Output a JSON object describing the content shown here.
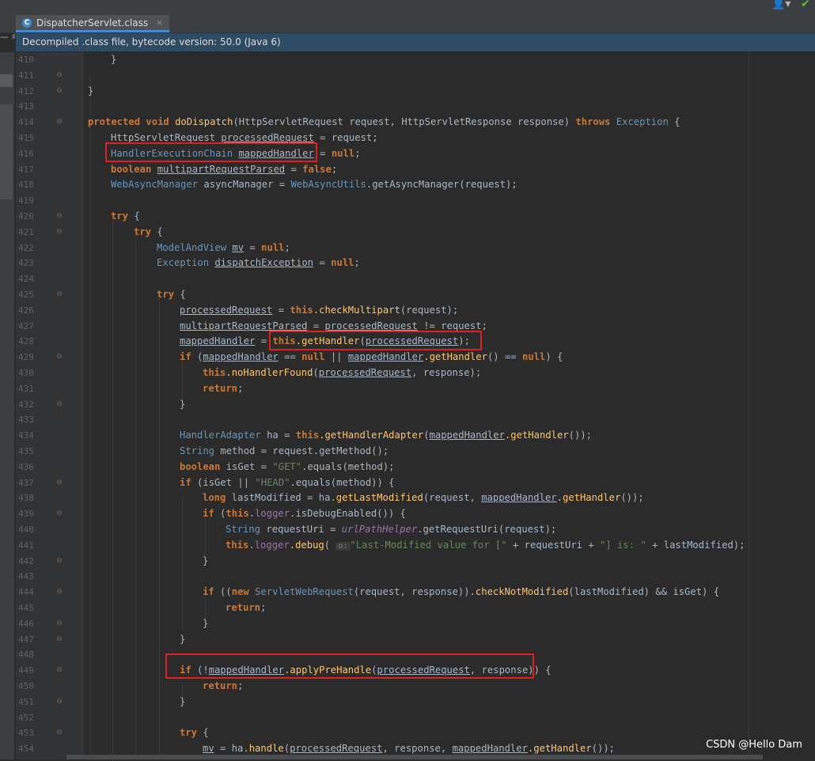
{
  "tab": {
    "icon": "C",
    "label": "DispatcherServlet.class",
    "close": "×"
  },
  "left_marks": "— ♯\\",
  "banner": "Decompiled .class file, bytecode version: 50.0 (Java 6)",
  "toolbar": {
    "user_glyph": "👤▾",
    "check_glyph": "✔"
  },
  "watermark": "CSDN @Hello Dam",
  "lines": [
    {
      "n": "410",
      "indent": 4
    },
    {
      "n": "411",
      "indent": 0
    },
    {
      "n": "412",
      "indent": 0
    },
    {
      "n": "413",
      "indent": 0
    },
    {
      "n": "414",
      "indent": 0
    },
    {
      "n": "415",
      "indent": 0
    },
    {
      "n": "416",
      "indent": 0
    },
    {
      "n": "417",
      "indent": 0
    },
    {
      "n": "418",
      "indent": 0
    },
    {
      "n": "419",
      "indent": 0
    },
    {
      "n": "420",
      "indent": 0
    },
    {
      "n": "421",
      "indent": 0
    },
    {
      "n": "422",
      "indent": 0
    },
    {
      "n": "423",
      "indent": 0
    },
    {
      "n": "424",
      "indent": 0
    },
    {
      "n": "425",
      "indent": 0
    },
    {
      "n": "426",
      "indent": 0
    },
    {
      "n": "427",
      "indent": 0
    },
    {
      "n": "428",
      "indent": 0
    },
    {
      "n": "429",
      "indent": 0
    },
    {
      "n": "430",
      "indent": 0
    },
    {
      "n": "431",
      "indent": 0
    },
    {
      "n": "432",
      "indent": 0
    },
    {
      "n": "433",
      "indent": 0
    },
    {
      "n": "434",
      "indent": 0
    },
    {
      "n": "435",
      "indent": 0
    },
    {
      "n": "436",
      "indent": 0
    },
    {
      "n": "437",
      "indent": 0
    },
    {
      "n": "438",
      "indent": 0
    },
    {
      "n": "439",
      "indent": 0
    },
    {
      "n": "440",
      "indent": 0
    },
    {
      "n": "441",
      "indent": 0
    },
    {
      "n": "442",
      "indent": 0
    },
    {
      "n": "443",
      "indent": 0
    },
    {
      "n": "444",
      "indent": 0
    },
    {
      "n": "445",
      "indent": 0
    },
    {
      "n": "446",
      "indent": 0
    },
    {
      "n": "447",
      "indent": 0
    },
    {
      "n": "448",
      "indent": 0
    },
    {
      "n": "449",
      "indent": 0
    },
    {
      "n": "450",
      "indent": 0
    },
    {
      "n": "451",
      "indent": 0
    },
    {
      "n": "452",
      "indent": 0
    },
    {
      "n": "453",
      "indent": 0
    },
    {
      "n": "454",
      "indent": 0
    }
  ],
  "code": {
    "l410": "}",
    "l412": "}",
    "l414_kw1": "protected",
    "l414_kw2": "void",
    "l414_fn": "doDispatch",
    "l414_rest": "(HttpServletRequest request, HttpServletResponse response) ",
    "l414_kw3": "throws",
    "l414_exc": "Exception",
    "l414_end": " {",
    "l415_type": "HttpServletRequest ",
    "l415_var": "processedRequest",
    "l415_rest": " = request;",
    "l416_type": "HandlerExecutionChain",
    "l416_var": "mappedHandler",
    "l416_eq": " = ",
    "l416_null": "null",
    "l416_end": ";",
    "l417_kw": "boolean",
    "l417_var": "multipartRequestParsed",
    "l417_eq": " = ",
    "l417_false": "false",
    "l417_end": ";",
    "l418_type": "WebAsyncManager",
    "l418_mid": " asyncManager = ",
    "l418_cls": "WebAsyncUtils",
    "l418_rest": ".getAsyncManager(request);",
    "l420_kw": "try",
    "l420_end": " {",
    "l421_kw": "try",
    "l421_end": " {",
    "l422_type": "ModelAndView",
    "l422_var": "mv",
    "l422_eq": " = ",
    "l422_null": "null",
    "l422_end": ";",
    "l423_type": "Exception",
    "l423_var": "dispatchException",
    "l423_eq": " = ",
    "l423_null": "null",
    "l423_end": ";",
    "l425_kw": "try",
    "l425_end": " {",
    "l426_var": "processedRequest",
    "l426_eq": " = ",
    "l426_this": "this",
    "l426_fn": ".checkMultipart",
    "l426_rest": "(request);",
    "l427_var": "multipartRequestParsed",
    "l427_eq": " = ",
    "l427_var2": "processedRequest",
    "l427_rest": " != request;",
    "l428_var": "mappedHandler",
    "l428_eq": " = ",
    "l428_this": "this",
    "l428_fn": ".getHandler",
    "l428_open": "(",
    "l428_arg": "processedRequest",
    "l428_end": ");",
    "l429_kw": "if",
    "l429_open": " (",
    "l429_var": "mappedHandler",
    "l429_mid": " == ",
    "l429_null": "null",
    "l429_or": " || ",
    "l429_var2": "mappedHandler",
    "l429_fn": ".getHandler",
    "l429_mid2": "() == ",
    "l429_null2": "null",
    "l429_end": ") {",
    "l430_this": "this",
    "l430_fn": ".noHandlerFound",
    "l430_open": "(",
    "l430_arg": "processedRequest",
    "l430_rest": ", response);",
    "l431_kw": "return",
    "l431_end": ";",
    "l432": "}",
    "l434_type": "HandlerAdapter",
    "l434_mid": " ha = ",
    "l434_this": "this",
    "l434_fn": ".getHandlerAdapter",
    "l434_open": "(",
    "l434_var": "mappedHandler",
    "l434_fn2": ".getHandler",
    "l434_end": "());",
    "l435_type": "String",
    "l435_rest": " method = request.getMethod();",
    "l436_kw": "boolean",
    "l436_mid": " isGet = ",
    "l436_str": "\"GET\"",
    "l436_rest": ".equals(method);",
    "l437_kw": "if",
    "l437_mid": " (isGet || ",
    "l437_str": "\"HEAD\"",
    "l437_rest": ".equals(method)) {",
    "l438_kw": "long",
    "l438_mid": " lastModified = ha.",
    "l438_fn": "getLastModified",
    "l438_mid2": "(request, ",
    "l438_var": "mappedHandler",
    "l438_fn2": ".getHandler",
    "l438_end": "());",
    "l439_kw": "if",
    "l439_open": " (",
    "l439_this": "this",
    "l439_dot": ".",
    "l439_fld": "logger",
    "l439_rest": ".isDebugEnabled()) {",
    "l440_type": "String",
    "l440_mid": " requestUri = ",
    "l440_fld": "urlPathHelper",
    "l440_rest": ".getRequestUri(request);",
    "l441_this": "this",
    "l441_dot": ".",
    "l441_fld": "logger",
    "l441_fn": ".debug",
    "l441_open": "( ",
    "l441_hint": "o:",
    "l441_str": "\"Last-Modified value for [\"",
    "l441_mid": " + requestUri + ",
    "l441_str2": "\"] is: \"",
    "l441_rest": " + lastModified);",
    "l442": "}",
    "l444_kw": "if",
    "l444_open": " ((",
    "l444_kw2": "new",
    "l444_cls": " ServletWebRequest",
    "l444_mid": "(request, response)).",
    "l444_fn": "checkNotModified",
    "l444_rest": "(lastModified) && isGet) {",
    "l445_kw": "return",
    "l445_end": ";",
    "l446": "}",
    "l447": "}",
    "l449_kw": "if",
    "l449_open": " (!",
    "l449_var": "mappedHandler",
    "l449_fn": ".applyPreHandle",
    "l449_open2": "(",
    "l449_arg": "processedRequest",
    "l449_rest": ", response)) {",
    "l450_kw": "return",
    "l450_end": ";",
    "l451": "}",
    "l453_kw": "try",
    "l453_end": " {",
    "l454_var": "mv",
    "l454_mid": " = ha.",
    "l454_fn": "handle",
    "l454_open": "(",
    "l454_arg": "processedRequest",
    "l454_mid2": ", response, ",
    "l454_var2": "mappedHandler",
    "l454_fn2": ".getHandler",
    "l454_end": "());"
  }
}
